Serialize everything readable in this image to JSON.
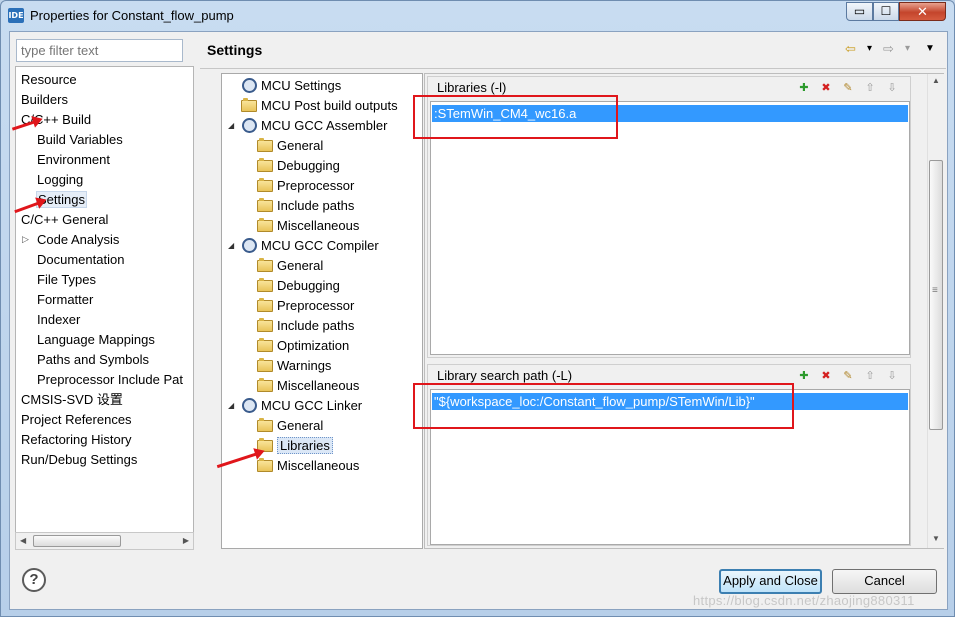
{
  "window": {
    "title": "Properties for Constant_flow_pump",
    "app_icon_text": "IDE",
    "minimize_glyph": "▭",
    "maximize_glyph": "☐",
    "close_glyph": "✕"
  },
  "filter": {
    "placeholder": "type filter text"
  },
  "nav": {
    "items": [
      {
        "label": "Resource"
      },
      {
        "label": "Builders"
      },
      {
        "label": "C/C++ Build"
      },
      {
        "label": "Build Variables"
      },
      {
        "label": "Environment"
      },
      {
        "label": "Logging"
      },
      {
        "label": "Settings"
      },
      {
        "label": "C/C++ General"
      },
      {
        "label": "Code Analysis"
      },
      {
        "label": "Documentation"
      },
      {
        "label": "File Types"
      },
      {
        "label": "Formatter"
      },
      {
        "label": "Indexer"
      },
      {
        "label": "Language Mappings"
      },
      {
        "label": "Paths and Symbols"
      },
      {
        "label": "Preprocessor Include Pat"
      },
      {
        "label": "CMSIS-SVD 设置"
      },
      {
        "label": "Project References"
      },
      {
        "label": "Refactoring History"
      },
      {
        "label": "Run/Debug Settings"
      }
    ],
    "expander_glyph": "▷",
    "scroll_left_glyph": "◀",
    "scroll_right_glyph": "▶"
  },
  "settings": {
    "title": "Settings"
  },
  "header_icons": {
    "back": "⇦",
    "back_menu": "▾",
    "forward": "⇨",
    "forward_menu": "▾",
    "view_menu": "▼"
  },
  "tool_tree": {
    "expand_glyph": "◢",
    "items": [
      {
        "label": "MCU Settings"
      },
      {
        "label": "MCU Post build outputs"
      },
      {
        "label": "MCU GCC Assembler"
      },
      {
        "label": "General"
      },
      {
        "label": "Debugging"
      },
      {
        "label": "Preprocessor"
      },
      {
        "label": "Include paths"
      },
      {
        "label": "Miscellaneous"
      },
      {
        "label": "MCU GCC Compiler"
      },
      {
        "label": "General"
      },
      {
        "label": "Debugging"
      },
      {
        "label": "Preprocessor"
      },
      {
        "label": "Include paths"
      },
      {
        "label": "Optimization"
      },
      {
        "label": "Warnings"
      },
      {
        "label": "Miscellaneous"
      },
      {
        "label": "MCU GCC Linker"
      },
      {
        "label": "General"
      },
      {
        "label": "Libraries"
      },
      {
        "label": "Miscellaneous"
      }
    ]
  },
  "libraries": {
    "label": "Libraries (-l)",
    "values": [
      ":STemWin_CM4_wc16.a"
    ]
  },
  "library_search_path": {
    "label": "Library search path (-L)",
    "values": [
      "\"${workspace_loc:/Constant_flow_pump/STemWin/Lib}\""
    ]
  },
  "list_tools": {
    "add": "✚",
    "delete": "✖",
    "edit": "✎",
    "up": "⇧",
    "down": "⇩"
  },
  "scrollbar": {
    "up_glyph": "▲",
    "down_glyph": "▼",
    "grip_glyph": "≡"
  },
  "footer": {
    "help_glyph": "?",
    "apply_close": "Apply and Close",
    "cancel": "Cancel",
    "watermark": "https://blog.csdn.net/zhaojing880311"
  },
  "colors": {
    "selection": "#3399ff",
    "annotation_red": "#e0161b",
    "window_frame": "#bfd3e9"
  }
}
